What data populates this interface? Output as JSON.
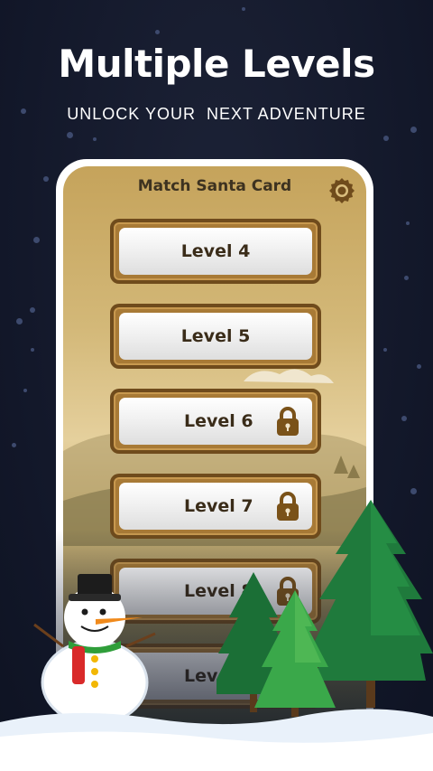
{
  "header": {
    "headline": "Multiple Levels",
    "tagline": "UNLOCK YOUR  NEXT ADVENTURE"
  },
  "app": {
    "title": "Match Santa Card",
    "settings_icon": "gear-icon"
  },
  "levels": [
    {
      "label": "Level 4",
      "locked": false
    },
    {
      "label": "Level 5",
      "locked": false
    },
    {
      "label": "Level 6",
      "locked": true
    },
    {
      "label": "Level 7",
      "locked": true
    },
    {
      "label": "Level 8",
      "locked": true
    },
    {
      "label": "Level 9",
      "locked": true
    }
  ],
  "colors": {
    "background": "#141a2b",
    "button_frame": "#6f4b1c",
    "button_face": "#f1f1f1",
    "level_text": "#3a2c19",
    "lock": "#7a5219"
  }
}
